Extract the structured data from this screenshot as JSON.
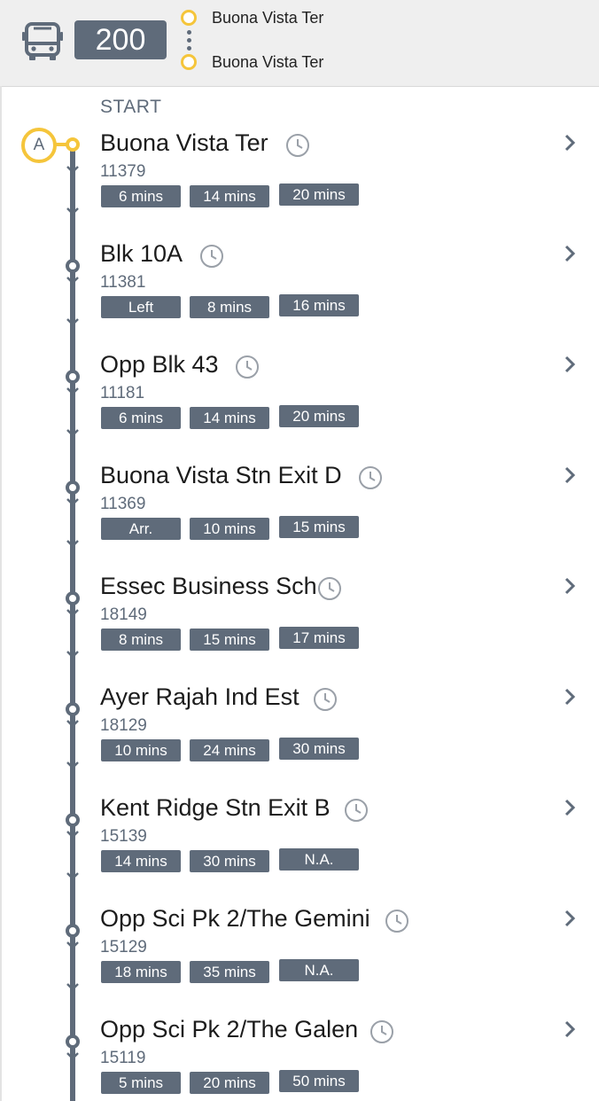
{
  "header": {
    "route_number": "200",
    "origin": "Buona Vista Ter",
    "destination": "Buona Vista Ter",
    "icon": "bus-icon",
    "accent_color": "#f5c53b",
    "badge_color": "#5f6b7a"
  },
  "timeline": {
    "start_label": "START",
    "start_marker": "A"
  },
  "stops": [
    {
      "name": "Buona Vista Ter",
      "code": "11379",
      "arrivals": [
        "6 mins",
        "14 mins",
        "20 mins"
      ]
    },
    {
      "name": "Blk 10A",
      "code": "11381",
      "arrivals": [
        "Left",
        "8 mins",
        "16 mins"
      ]
    },
    {
      "name": "Opp Blk 43",
      "code": "11181",
      "arrivals": [
        "6 mins",
        "14 mins",
        "20 mins"
      ]
    },
    {
      "name": "Buona Vista Stn Exit D",
      "code": "11369",
      "arrivals": [
        "Arr.",
        "10 mins",
        "15 mins"
      ]
    },
    {
      "name": "Essec Business Sch",
      "code": "18149",
      "arrivals": [
        "8 mins",
        "15 mins",
        "17 mins"
      ]
    },
    {
      "name": "Ayer Rajah Ind Est",
      "code": "18129",
      "arrivals": [
        "10 mins",
        "24 mins",
        "30 mins"
      ]
    },
    {
      "name": "Kent Ridge Stn Exit B",
      "code": "15139",
      "arrivals": [
        "14 mins",
        "30 mins",
        "N.A."
      ]
    },
    {
      "name": "Opp Sci Pk 2/The Gemini",
      "code": "15129",
      "arrivals": [
        "18 mins",
        "35 mins",
        "N.A."
      ]
    },
    {
      "name": "Opp Sci Pk 2/The Galen",
      "code": "15119",
      "arrivals": [
        "5 mins",
        "20 mins",
        "50 mins"
      ]
    }
  ]
}
